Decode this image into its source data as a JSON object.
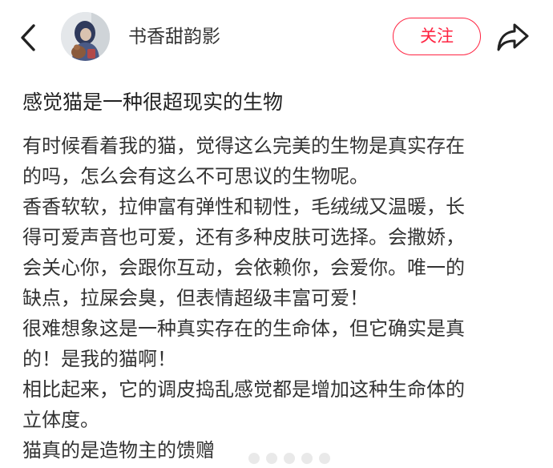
{
  "header": {
    "back_icon": "chevron-left-icon",
    "author_name": "书香甜韵影",
    "follow_label": "关注",
    "share_icon": "share-arrow-icon",
    "accent_color": "#ff2442"
  },
  "post": {
    "title": "感觉猫是一种很超现实的生物",
    "lines": [
      "有时候看着我的猫，觉得这么完美的生物是真实存在",
      "的吗，怎么会有这么不可思议的生物呢。",
      "香香软软，拉伸富有弹性和韧性，毛绒绒又温暖，长",
      "得可爱声音也可爱，还有多种皮肤可选择。会撒娇，",
      "会关心你，会跟你互动，会依赖你，会爱你。唯一的",
      "缺点，拉屎会臭，但表情超级丰富可爱！",
      "很难想象这是一种真实存在的生命体，但它确实是真",
      "的！是我的猫啊！",
      "相比起来，它的调皮捣乱感觉都是增加这种生命体的",
      "立体度。",
      "猫真的是造物主的馈赠"
    ]
  }
}
